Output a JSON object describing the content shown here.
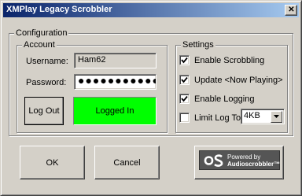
{
  "window": {
    "title": "XMPlay Legacy Scrobbler",
    "close_glyph": "✕"
  },
  "configuration": {
    "label": "Configuration",
    "account": {
      "label": "Account",
      "username_label": "Username:",
      "username_value": "Ham62",
      "password_label": "Password:",
      "password_value": "●●●●●●●●●●●●",
      "logout_label": "Log Out",
      "status_text": "Logged In",
      "status_color": "#00ff00"
    },
    "settings": {
      "label": "Settings",
      "items": [
        {
          "label": "Enable Scrobbling",
          "checked": true
        },
        {
          "label": "Update <Now Playing>",
          "checked": true
        },
        {
          "label": "Enable Logging",
          "checked": true
        },
        {
          "label": "Limit Log To:",
          "checked": false
        }
      ],
      "log_size_selected": "4KB"
    }
  },
  "buttons": {
    "ok": "OK",
    "cancel": "Cancel"
  },
  "branding": {
    "line1": "Powered by",
    "line2": "Audioscrobbler™",
    "icon": "lastfm-logo-icon"
  }
}
